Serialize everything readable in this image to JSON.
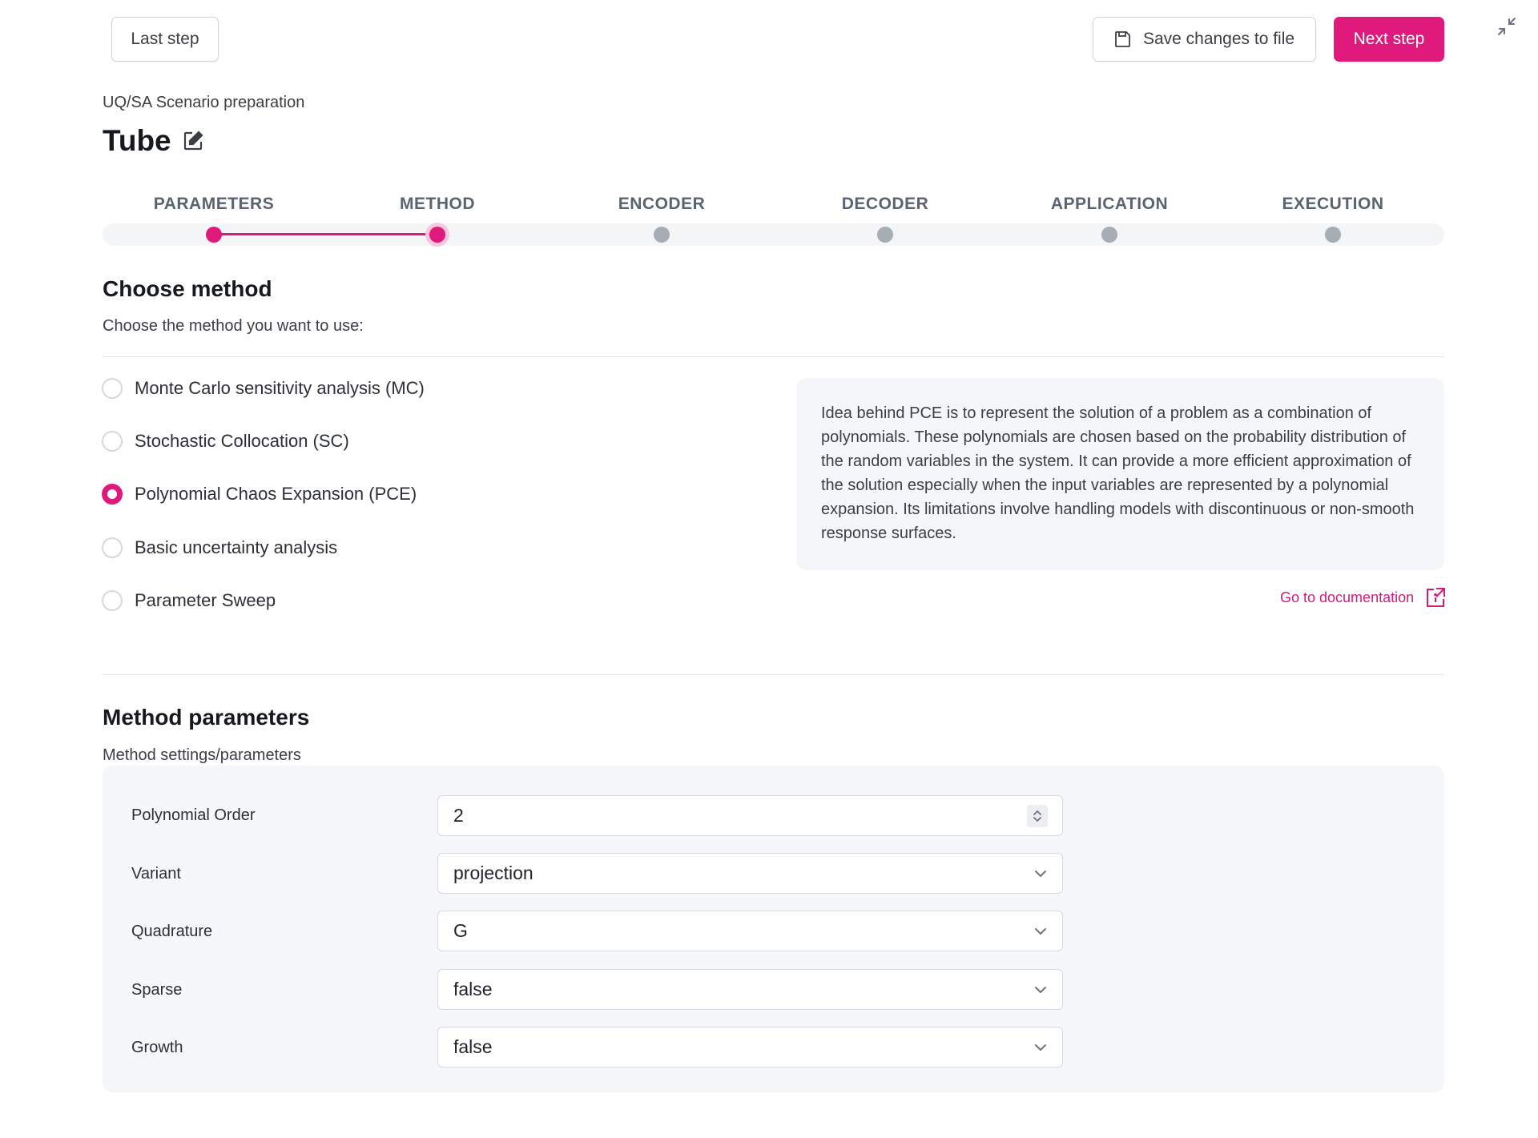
{
  "toolbar": {
    "last_step": "Last step",
    "save": "Save changes to file",
    "next_step": "Next step"
  },
  "header": {
    "subtitle": "UQ/SA Scenario preparation",
    "title": "Tube"
  },
  "stepper": {
    "steps": [
      "PARAMETERS",
      "METHOD",
      "ENCODER",
      "DECODER",
      "APPLICATION",
      "EXECUTION"
    ],
    "current": "METHOD"
  },
  "choose": {
    "heading": "Choose method",
    "subheading": "Choose the method you want to use:",
    "options": [
      "Monte Carlo sensitivity analysis (MC)",
      "Stochastic Collocation (SC)",
      "Polynomial Chaos Expansion (PCE)",
      "Basic uncertainty analysis",
      "Parameter Sweep"
    ],
    "selected": "Polynomial Chaos Expansion (PCE)",
    "description": "Idea behind PCE is to represent the solution of a problem as a combination of polynomials. These polynomials are chosen based on the probability distribution of the random variables in the system. It can provide a more efficient approximation of the solution especially when the input variables are represented by a polynomial expansion. Its limitations involve handling models with discontinuous or non-smooth response surfaces.",
    "doc_link": "Go to documentation"
  },
  "params": {
    "heading": "Method parameters",
    "subheading": "Method settings/parameters",
    "fields": [
      {
        "label": "Polynomial Order",
        "value": "2"
      },
      {
        "label": "Variant",
        "value": "projection"
      },
      {
        "label": "Quadrature",
        "value": "G"
      },
      {
        "label": "Sparse",
        "value": "false"
      },
      {
        "label": "Growth",
        "value": "false"
      }
    ]
  },
  "colors": {
    "accent": "#e01a7d",
    "inactive_dot": "#a7adb4"
  }
}
